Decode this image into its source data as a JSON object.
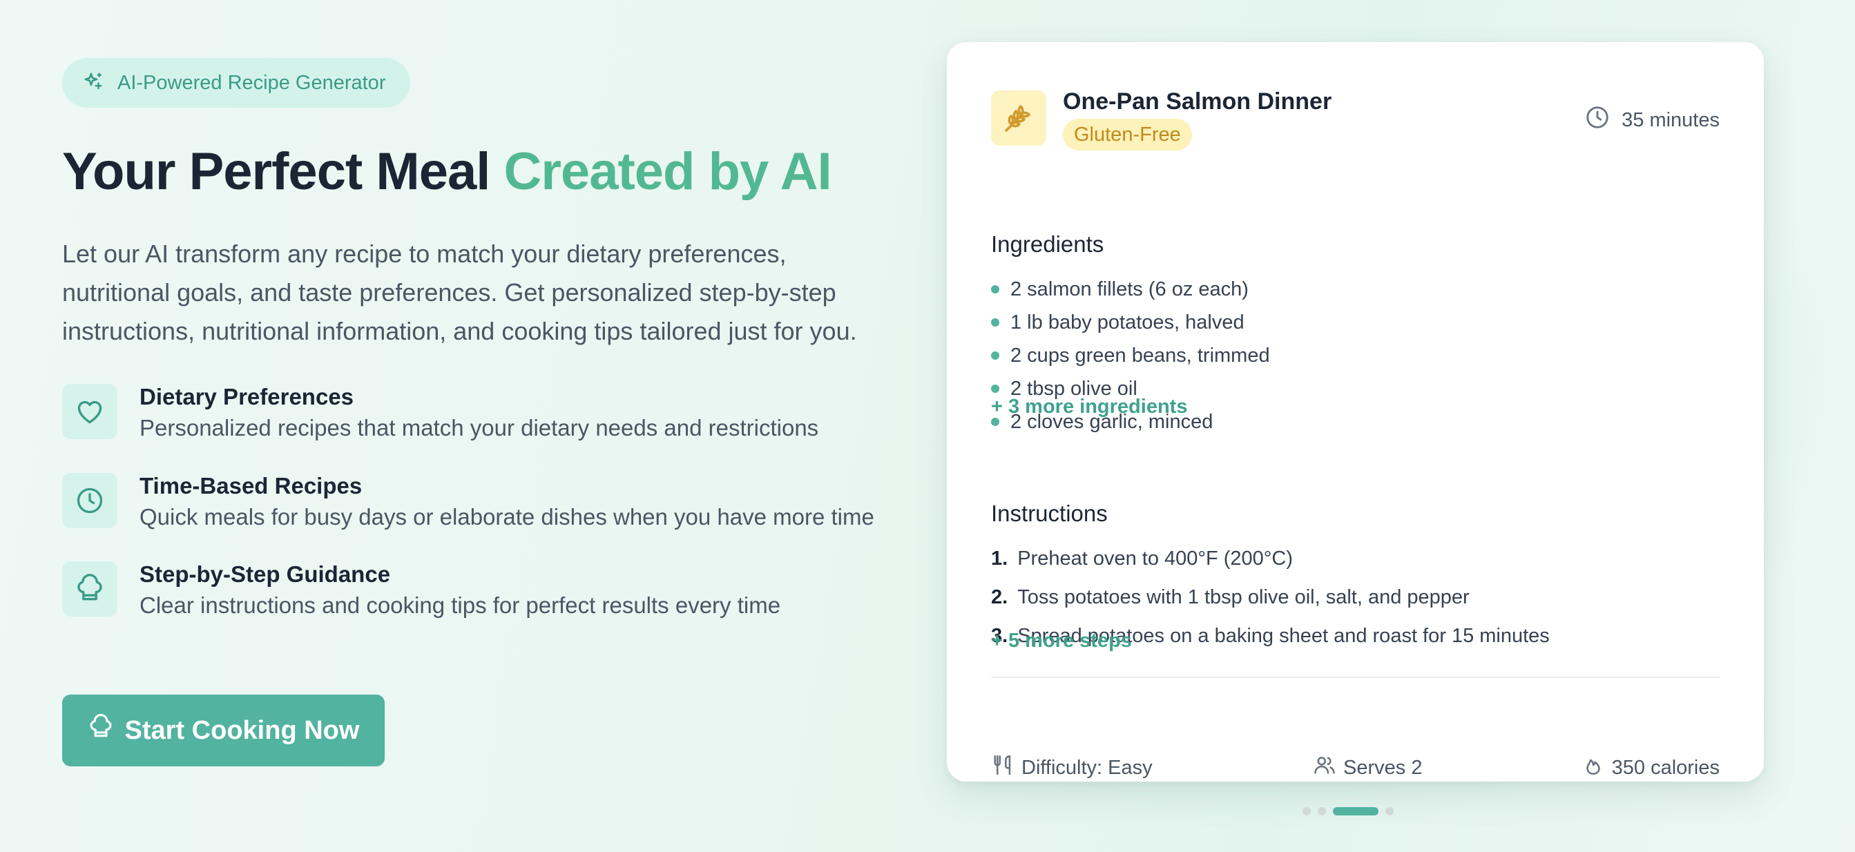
{
  "hero": {
    "badge_label": "AI-Powered Recipe Generator",
    "headline_main": "Your Perfect Meal ",
    "headline_accent": "Created by AI",
    "intro": "Let our AI transform any recipe to match your dietary preferences, nutritional goals, and taste preferences. Get personalized step-by-step instructions, nutritional information, and cooking tips tailored just for you.",
    "features": [
      {
        "icon": "heart-icon",
        "title": "Dietary Preferences",
        "description": "Personalized recipes that match your dietary needs and restrictions"
      },
      {
        "icon": "clock-icon",
        "title": "Time-Based Recipes",
        "description": "Quick meals for busy days or elaborate dishes when you have more time"
      },
      {
        "icon": "chef-hat-icon",
        "title": "Step-by-Step Guidance",
        "description": "Clear instructions and cooking tips for perfect results every time"
      }
    ],
    "cta_label": "Start Cooking Now"
  },
  "recipe_card": {
    "icon": "wheat-icon",
    "title": "One-Pan Salmon Dinner",
    "diet_tag": "Gluten-Free",
    "time": "35 minutes",
    "ingredients_heading": "Ingredients",
    "ingredients": [
      "2 salmon fillets (6 oz each)",
      "1 lb baby potatoes, halved",
      "2 cups green beans, trimmed",
      "2 tbsp olive oil",
      "2 cloves garlic, minced"
    ],
    "more_ingredients": "+ 3 more ingredients",
    "instructions_heading": "Instructions",
    "steps": [
      {
        "num": "1.",
        "text": "Preheat oven to 400°F (200°C)"
      },
      {
        "num": "2.",
        "text": "Toss potatoes with 1 tbsp olive oil, salt, and pepper"
      },
      {
        "num": "3.",
        "text": "Spread potatoes on a baking sheet and roast for 15 minutes"
      }
    ],
    "more_steps": "+ 5 more steps",
    "difficulty": "Difficulty: Easy",
    "serves": "Serves 2",
    "calories": "350 calories"
  },
  "carousel": {
    "total": 4,
    "active_index": 2
  },
  "colors": {
    "accent": "#52b3a0",
    "headline_accent": "#52b893",
    "badge_bg": "#d3f3ea",
    "diet_tag_bg": "#fdf2b9",
    "diet_tag_text": "#c28a1b"
  }
}
